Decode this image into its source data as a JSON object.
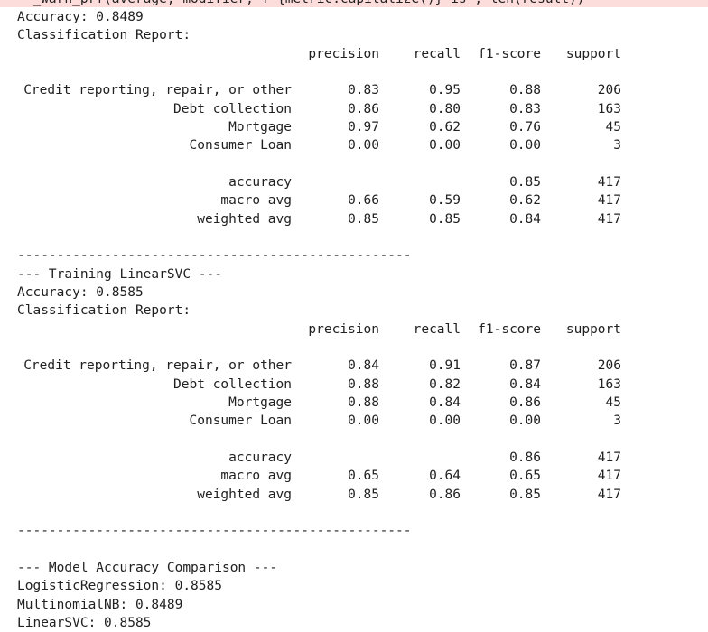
{
  "stderr_partial": "  _warn_prf(average, modifier, f\"{metric.capitalize()} is\", len(result))",
  "block1": {
    "accuracy_line": "Accuracy: 0.8489",
    "report_title": "Classification Report:",
    "headers": [
      "precision",
      "recall",
      "f1-score",
      "support"
    ],
    "rows": [
      {
        "label": "Credit reporting, repair, or other",
        "precision": "0.83",
        "recall": "0.95",
        "f1": "0.88",
        "support": "206"
      },
      {
        "label": "Debt collection",
        "precision": "0.86",
        "recall": "0.80",
        "f1": "0.83",
        "support": "163"
      },
      {
        "label": "Mortgage",
        "precision": "0.97",
        "recall": "0.62",
        "f1": "0.76",
        "support": "45"
      },
      {
        "label": "Consumer Loan",
        "precision": "0.00",
        "recall": "0.00",
        "f1": "0.00",
        "support": "3"
      }
    ],
    "summary": [
      {
        "label": "accuracy",
        "precision": "",
        "recall": "",
        "f1": "0.85",
        "support": "417"
      },
      {
        "label": "macro avg",
        "precision": "0.66",
        "recall": "0.59",
        "f1": "0.62",
        "support": "417"
      },
      {
        "label": "weighted avg",
        "precision": "0.85",
        "recall": "0.85",
        "f1": "0.84",
        "support": "417"
      }
    ]
  },
  "separator": "--------------------------------------------------",
  "block2": {
    "title_line": "--- Training LinearSVC ---",
    "accuracy_line": "Accuracy: 0.8585",
    "report_title": "Classification Report:",
    "headers": [
      "precision",
      "recall",
      "f1-score",
      "support"
    ],
    "rows": [
      {
        "label": "Credit reporting, repair, or other",
        "precision": "0.84",
        "recall": "0.91",
        "f1": "0.87",
        "support": "206"
      },
      {
        "label": "Debt collection",
        "precision": "0.88",
        "recall": "0.82",
        "f1": "0.84",
        "support": "163"
      },
      {
        "label": "Mortgage",
        "precision": "0.88",
        "recall": "0.84",
        "f1": "0.86",
        "support": "45"
      },
      {
        "label": "Consumer Loan",
        "precision": "0.00",
        "recall": "0.00",
        "f1": "0.00",
        "support": "3"
      }
    ],
    "summary": [
      {
        "label": "accuracy",
        "precision": "",
        "recall": "",
        "f1": "0.86",
        "support": "417"
      },
      {
        "label": "macro avg",
        "precision": "0.65",
        "recall": "0.64",
        "f1": "0.65",
        "support": "417"
      },
      {
        "label": "weighted avg",
        "precision": "0.85",
        "recall": "0.86",
        "f1": "0.85",
        "support": "417"
      }
    ]
  },
  "comparison": {
    "title_line": "--- Model Accuracy Comparison ---",
    "lines": [
      "LogisticRegression: 0.8585",
      "MultinomialNB: 0.8489",
      "LinearSVC: 0.8585"
    ]
  },
  "colors": {
    "stderr_background": "#fddcdc",
    "text": "#212121",
    "background": "#ffffff"
  }
}
